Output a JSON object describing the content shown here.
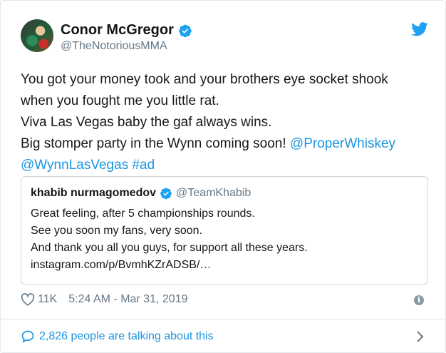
{
  "author": {
    "display_name": "Conor McGregor",
    "handle": "@TheNotoriousMMA",
    "verified": true
  },
  "tweet": {
    "lines": [
      "You got your money took and your brothers eye socket shook",
      "when you fought me you little rat.",
      "Viva Las Vegas baby the gaf always wins.",
      "Big stomper party in the Wynn coming soon! "
    ],
    "mention_proper": "@ProperWhiskey",
    "mention_wynn": "@WynnLasVegas",
    "hashtag": " #ad"
  },
  "quoted_tweet": {
    "display_name": "khabib nurmagomedov",
    "handle": "@TeamKhabib",
    "lines": [
      "Great feeling, after 5 championships rounds.",
      "See you soon my fans, very soon.",
      "And thank you all you guys, for support all these years.",
      "instagram.com/p/BvmhKZrADSB/…"
    ]
  },
  "meta": {
    "like_count": "11K",
    "timestamp": "5:24 AM - Mar 31, 2019"
  },
  "footer": {
    "talking_text": "2,826 people are talking about this"
  },
  "colors": {
    "link": "#1b95e0",
    "text": "#14171a",
    "secondary": "#657786",
    "border": "#e1e8ed"
  },
  "icons": [
    "twitter-bird-icon",
    "verified-badge-icon",
    "heart-icon",
    "info-icon",
    "speech-bubble-icon",
    "chevron-right-icon"
  ]
}
